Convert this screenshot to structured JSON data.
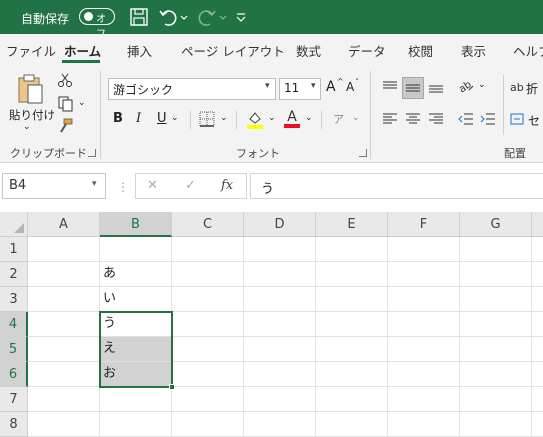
{
  "titlebar": {
    "autosave_label": "自動保存",
    "autosave_state": "オフ",
    "icons": [
      "save-icon",
      "undo-icon",
      "redo-icon",
      "customize-qat-icon"
    ]
  },
  "tabs": [
    "ファイル",
    "ホーム",
    "挿入",
    "ページ レイアウト",
    "数式",
    "データ",
    "校閲",
    "表示",
    "ヘルプ"
  ],
  "ribbon": {
    "clipboard": {
      "paste_label": "貼り付け",
      "group_label": "クリップボード"
    },
    "font": {
      "font_name": "游ゴシック",
      "font_size": "11",
      "bold": "B",
      "italic": "I",
      "underline": "U",
      "grow": "A",
      "shrink": "A",
      "font_color_letter": "A",
      "phonetic": "ア",
      "group_label": "フォント"
    },
    "alignment": {
      "wrap_label": "折",
      "merge_label": "セ",
      "group_label": "配置"
    },
    "colors": {
      "accent": "#217346",
      "font_color": "#e81123",
      "highlight": "#ffff00"
    }
  },
  "formula_bar": {
    "name_box": "B4",
    "cancel": "✕",
    "enter": "✓",
    "fx": "fx",
    "content": "う"
  },
  "grid": {
    "columns": [
      "A",
      "B",
      "C",
      "D",
      "E",
      "F",
      "G"
    ],
    "rows": [
      "1",
      "2",
      "3",
      "4",
      "5",
      "6",
      "7",
      "8"
    ],
    "active_cell": "B4",
    "selection": "B4:B6",
    "cells": {
      "B2": "あ",
      "B3": "い",
      "B4": "う",
      "B5": "え",
      "B6": "お"
    }
  }
}
